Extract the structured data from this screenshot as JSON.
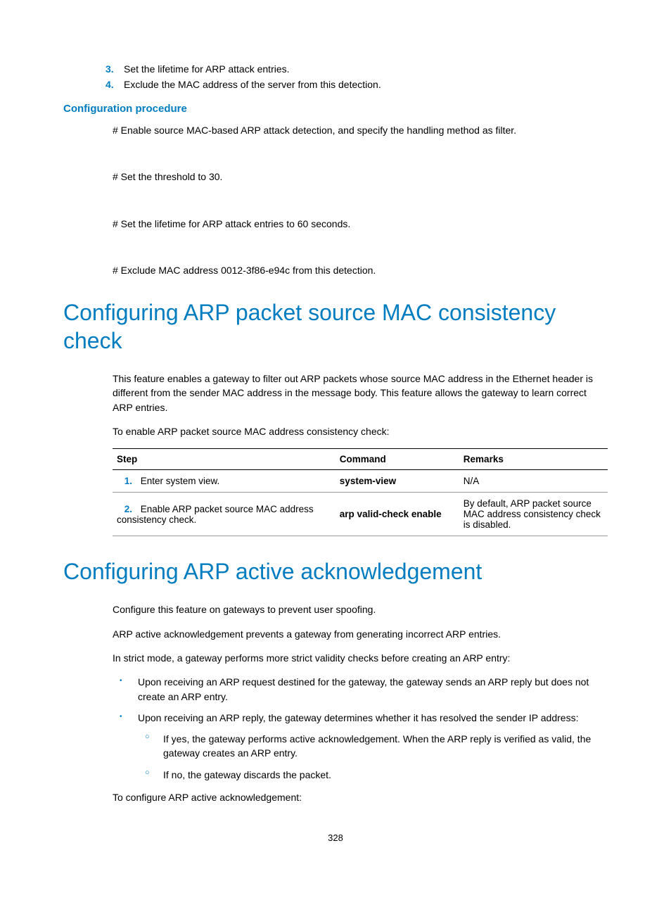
{
  "intro_list": [
    {
      "num": "3.",
      "text": "Set the lifetime for ARP attack entries."
    },
    {
      "num": "4.",
      "text": "Exclude the MAC address of the server from this detection."
    }
  ],
  "config_proc_heading": "Configuration procedure",
  "config_steps": [
    "# Enable source MAC-based ARP attack detection, and specify the handling method as filter.",
    "# Set the threshold to 30.",
    "# Set the lifetime for ARP attack entries to 60 seconds.",
    "# Exclude MAC address 0012-3f86-e94c from this detection."
  ],
  "section1": {
    "title": "Configuring ARP packet source MAC consistency check",
    "intro1": "This feature enables a gateway to filter out ARP packets whose source MAC address in the Ethernet header is different from the sender MAC address in the message body. This feature allows the gateway to learn correct ARP entries.",
    "intro2": "To enable ARP packet source MAC address consistency check:",
    "table": {
      "headers": {
        "step": "Step",
        "command": "Command",
        "remarks": "Remarks"
      },
      "rows": [
        {
          "num": "1.",
          "step": "Enter system view.",
          "command": "system-view",
          "remarks": "N/A"
        },
        {
          "num": "2.",
          "step": "Enable ARP packet source MAC address consistency check.",
          "command": "arp valid-check enable",
          "remarks": "By default, ARP packet source MAC address consistency check is disabled."
        }
      ]
    }
  },
  "section2": {
    "title": "Configuring ARP active acknowledgement",
    "p1": "Configure this feature on gateways to prevent user spoofing.",
    "p2": "ARP active acknowledgement prevents a gateway from generating incorrect ARP entries.",
    "p3": "In strict mode, a gateway performs more strict validity checks before creating an ARP entry:",
    "bullets": [
      "Upon receiving an ARP request destined for the gateway, the gateway sends an ARP reply but does not create an ARP entry.",
      "Upon receiving an ARP reply, the gateway determines whether it has resolved the sender IP address:"
    ],
    "subbullets": [
      "If yes, the gateway performs active acknowledgement. When the ARP reply is verified as valid, the gateway creates an ARP entry.",
      "If no, the gateway discards the packet."
    ],
    "p4": "To configure ARP active acknowledgement:"
  },
  "page_number": "328"
}
